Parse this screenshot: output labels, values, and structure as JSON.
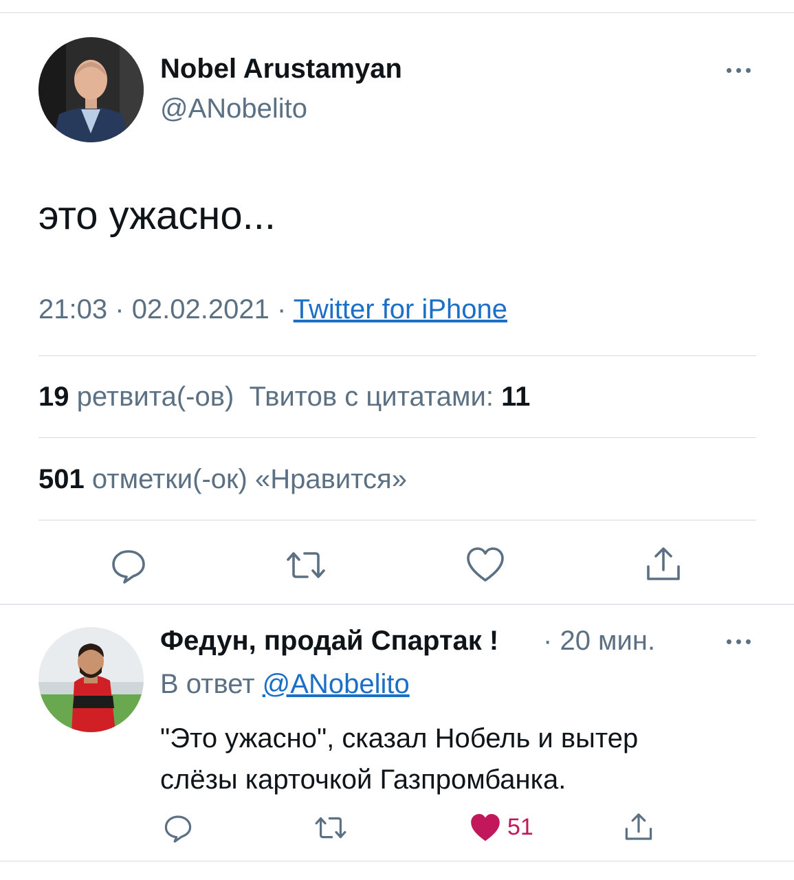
{
  "tweet": {
    "author_name": "Nobel Arustamyan",
    "author_handle": "@ANobelito",
    "text": "это ужасно...",
    "time": "21:03",
    "date": "02.02.2021",
    "dot": "·",
    "source": "Twitter for iPhone",
    "retweets_count": "19",
    "retweets_label": "ретвита(-ов)",
    "quotes_label": "Твитов с цитатами:",
    "quotes_count": "11",
    "likes_count": "501",
    "likes_label": "отметки(-ок) «Нравится»"
  },
  "reply": {
    "author_name": "Федун, продай Спартак !",
    "dot": "·",
    "time": "20 мин.",
    "reply_to_label": "В ответ",
    "reply_to_handle": "@ANobelito",
    "text_line1": "\"Это ужасно\", сказал Нобель и вытер",
    "text_line2": "слёзы карточкой Газпромбанка.",
    "likes_count": "51",
    "liked": true
  },
  "icons": {
    "reply": "reply-bubble-icon",
    "retweet": "retweet-icon",
    "like": "heart-icon",
    "share": "share-icon",
    "more": "more-horizontal-icon"
  },
  "colors": {
    "text": "#0f1419",
    "secondary": "#5b7083",
    "link": "#1b6fc7",
    "liked": "#c2185b"
  }
}
